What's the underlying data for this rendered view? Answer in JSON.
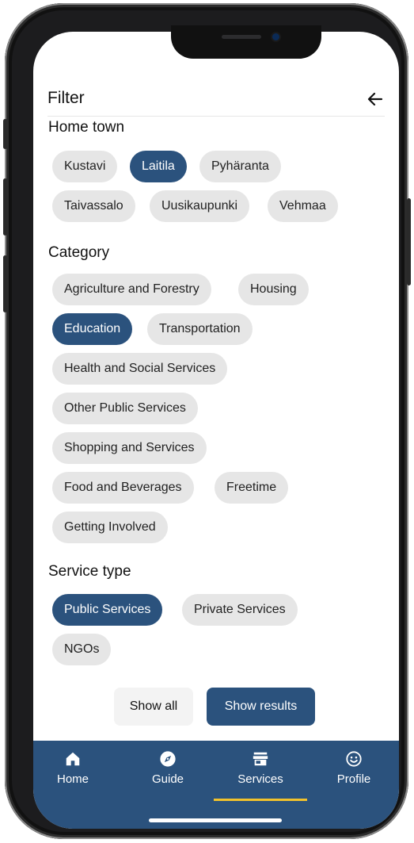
{
  "header": {
    "title": "Filter",
    "back_icon": "arrow-left-icon"
  },
  "home_town": {
    "title": "Home town",
    "chips": [
      {
        "label": "Kustavi",
        "selected": false
      },
      {
        "label": "Laitila",
        "selected": true
      },
      {
        "label": "Pyhäranta",
        "selected": false
      },
      {
        "label": "Taivassalo",
        "selected": false
      },
      {
        "label": "Uusikaupunki",
        "selected": false
      },
      {
        "label": "Vehmaa",
        "selected": false
      }
    ]
  },
  "category": {
    "title": "Category",
    "chips": [
      {
        "label": "Agriculture and Forestry",
        "selected": false
      },
      {
        "label": "Housing",
        "selected": false
      },
      {
        "label": "Education",
        "selected": true
      },
      {
        "label": "Transportation",
        "selected": false
      },
      {
        "label": "Health and Social Services",
        "selected": false
      },
      {
        "label": "Other Public Services",
        "selected": false
      },
      {
        "label": "Shopping and Services",
        "selected": false
      },
      {
        "label": "Food and Beverages",
        "selected": false
      },
      {
        "label": "Freetime",
        "selected": false
      },
      {
        "label": "Getting Involved",
        "selected": false
      }
    ]
  },
  "service_type": {
    "title": "Service type",
    "chips": [
      {
        "label": "Public Services",
        "selected": true
      },
      {
        "label": "Private Services",
        "selected": false
      },
      {
        "label": "NGOs",
        "selected": false
      }
    ]
  },
  "actions": {
    "show_all": "Show all",
    "show_results": "Show results"
  },
  "nav": {
    "items": [
      {
        "label": "Home",
        "icon": "home-icon",
        "active": false
      },
      {
        "label": "Guide",
        "icon": "compass-icon",
        "active": false
      },
      {
        "label": "Services",
        "icon": "store-icon",
        "active": true
      },
      {
        "label": "Profile",
        "icon": "smiley-icon",
        "active": false
      }
    ]
  },
  "colors": {
    "primary": "#2b527d",
    "chip": "#e6e6e6",
    "accent": "#f2c22c"
  }
}
